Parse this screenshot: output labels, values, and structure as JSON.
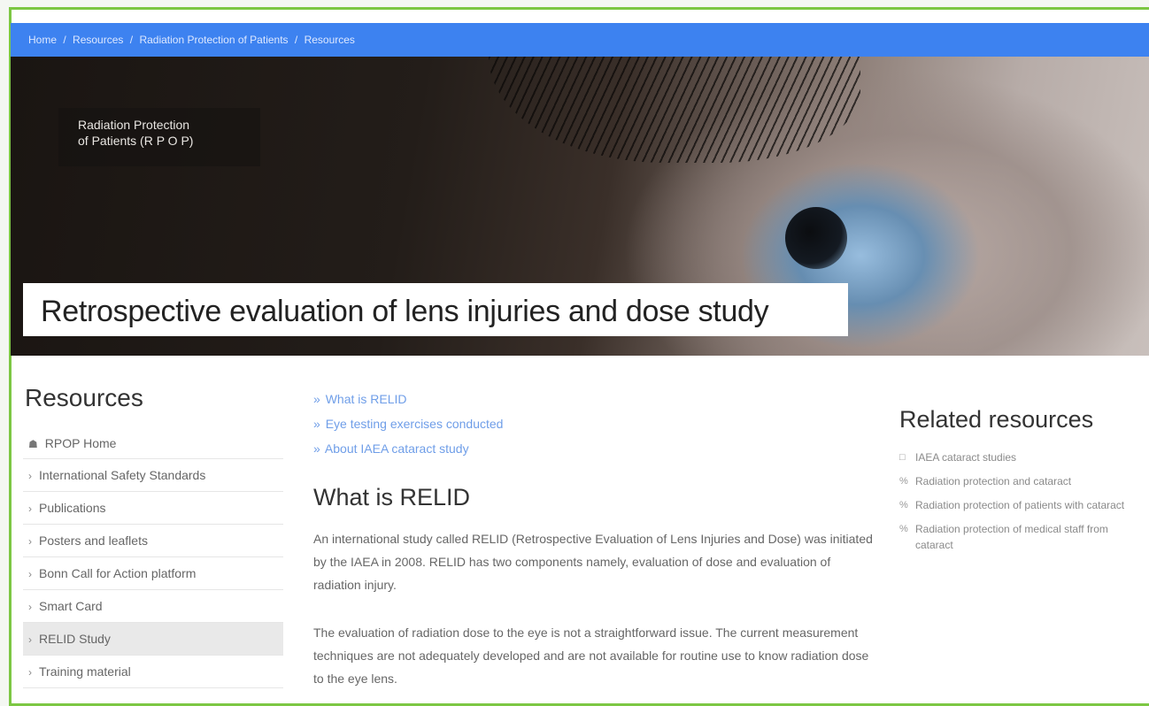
{
  "breadcrumb": {
    "items": [
      "Home",
      "Resources",
      "Radiation Protection of Patients",
      "Resources"
    ],
    "separator": "/"
  },
  "hero": {
    "badge_line1": "Radiation Protection",
    "badge_line2": "of Patients (R P O P)",
    "title": "Retrospective evaluation of lens injuries and dose study"
  },
  "sidebar": {
    "title": "Resources",
    "home_label": "RPOP Home",
    "items": [
      {
        "label": "International Safety Standards"
      },
      {
        "label": "Publications"
      },
      {
        "label": "Posters and leaflets"
      },
      {
        "label": "Bonn Call for Action platform"
      },
      {
        "label": "Smart Card"
      },
      {
        "label": "RELID Study"
      },
      {
        "label": "Training material"
      }
    ],
    "active_item": "RELID Study"
  },
  "toc": {
    "bullet": "»",
    "links": [
      "What is RELID",
      "Eye testing exercises conducted",
      "About IAEA cataract study"
    ]
  },
  "main": {
    "heading": "What is RELID",
    "paragraph1": "An international study called RELID (Retrospective Evaluation of Lens Injuries and Dose) was initiated by the IAEA in 2008. RELID has two components namely, evaluation of dose and evaluation of radiation injury.",
    "paragraph2": "The evaluation of radiation dose to the eye is not a straightforward issue. The current measurement techniques are not adequately developed and are not available for routine use to know radiation dose to the eye lens."
  },
  "related": {
    "title": "Related resources",
    "items": [
      {
        "label": "IAEA cataract studies",
        "icon": "document-icon"
      },
      {
        "label": "Radiation protection and cataract",
        "icon": "link-icon"
      },
      {
        "label": "Radiation protection of patients with cataract",
        "icon": "link-icon"
      },
      {
        "label": "Radiation protection of medical staff from cataract",
        "icon": "link-icon"
      }
    ]
  },
  "colors": {
    "frame_border": "#7cc743",
    "breadcrumb_bg": "#3d82f0",
    "link": "#6f9ee8"
  }
}
